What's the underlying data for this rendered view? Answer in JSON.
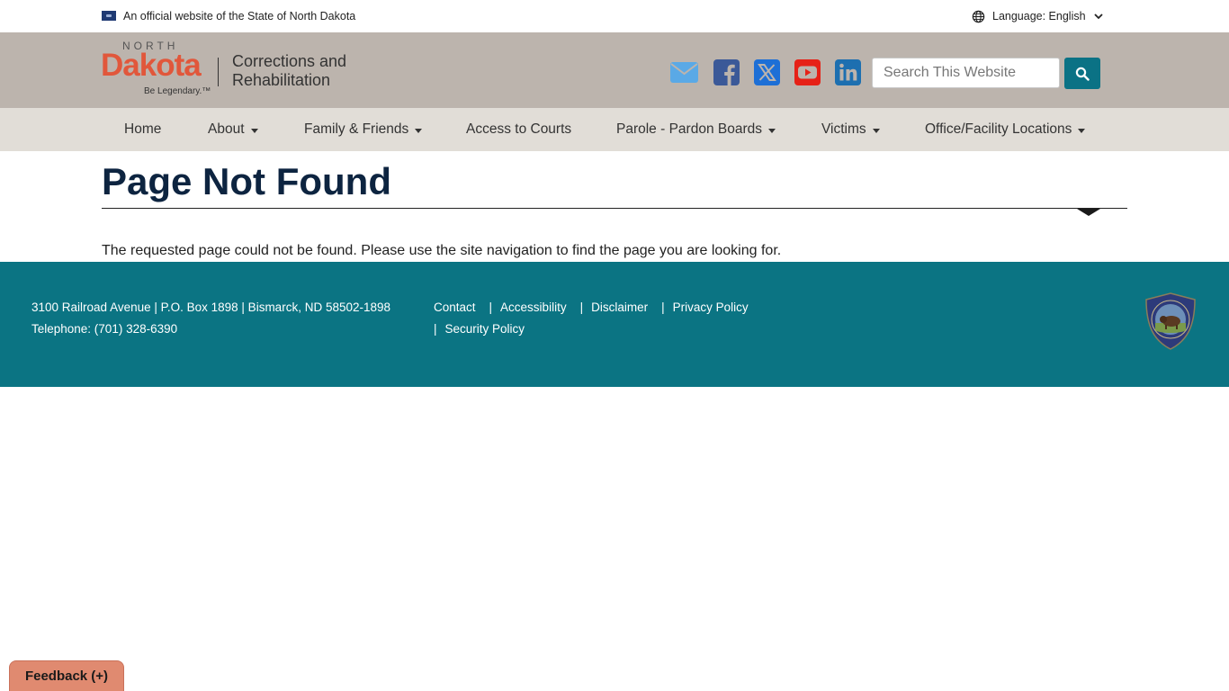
{
  "official_banner": {
    "text": "An official website of the State of North Dakota"
  },
  "language": {
    "label": "Language: English"
  },
  "logo": {
    "north": "NORTH",
    "dakota": "Dakota",
    "tagline": "Be Legendary.™",
    "agency": "Corrections and Rehabilitation"
  },
  "social": [
    {
      "name": "email-icon",
      "color": "#5aa9e6"
    },
    {
      "name": "facebook-icon",
      "color": "#3b5998"
    },
    {
      "name": "x-twitter-icon",
      "color": "#1d6fd6"
    },
    {
      "name": "youtube-icon",
      "color": "#e62117"
    },
    {
      "name": "linkedin-icon",
      "color": "#1d6fb0"
    }
  ],
  "search": {
    "placeholder": "Search This Website"
  },
  "nav": {
    "items": [
      {
        "label": "Home",
        "dropdown": false
      },
      {
        "label": "About",
        "dropdown": true
      },
      {
        "label": "Family & Friends",
        "dropdown": true
      },
      {
        "label": "Access to Courts",
        "dropdown": false
      },
      {
        "label": "Parole - Pardon Boards",
        "dropdown": true
      },
      {
        "label": "Victims",
        "dropdown": true
      },
      {
        "label": "Office/Facility Locations",
        "dropdown": true
      }
    ]
  },
  "main": {
    "title": "Page Not Found",
    "message": "The requested page could not be found. Please use the site navigation to find the page you are looking for."
  },
  "footer": {
    "address": "3100 Railroad Avenue | P.O. Box 1898 | Bismarck, ND 58502-1898",
    "telephone": "Telephone: (701) 328-6390",
    "links": [
      "Contact",
      "Accessibility",
      "Disclaimer",
      "Privacy Policy",
      "Security Policy"
    ],
    "separator": "|"
  },
  "feedback": {
    "label": "Feedback (+)"
  },
  "colors": {
    "header_bg": "#bcb4ad",
    "nav_bg": "#e1ddd7",
    "footer_bg": "#0b7483",
    "accent": "#0b7285",
    "logo_orange": "#e1573b",
    "feedback_bg": "#e08a70"
  }
}
